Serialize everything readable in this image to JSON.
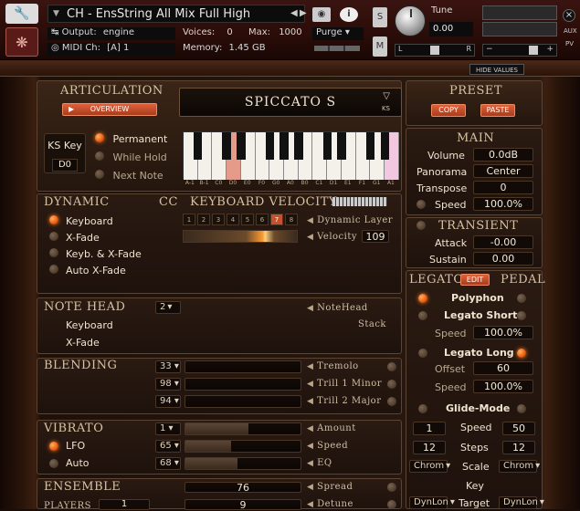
{
  "header": {
    "title": "CH - EnsString All Mix Full High",
    "output_label": "Output:",
    "output_value": "engine",
    "voices_label": "Voices:",
    "voices_value": "0",
    "max_label": "Max:",
    "max_value": "1000",
    "purge_label": "Purge",
    "midi_label": "MIDI Ch:",
    "midi_value": "[A] 1",
    "memory_label": "Memory:",
    "memory_value": "1.45 GB",
    "solo_label": "S",
    "mute_label": "M",
    "tune_label": "Tune",
    "tune_value": "0.00",
    "pan_left": "L",
    "pan_right": "R",
    "aux_label": "AUX",
    "pv_label": "PV",
    "vol_minus": "−",
    "vol_plus": "+",
    "hide_values": "HIDE VALUES"
  },
  "articulation": {
    "title": "ARTICULATION",
    "overview_label": "OVERVIEW",
    "selected": "SPICCATO S",
    "ks_badge": "KS",
    "ks_key_label": "KS Key",
    "ks_key_value": "D0",
    "modes": [
      {
        "label": "Permanent",
        "active": true
      },
      {
        "label": "While Hold",
        "active": false
      },
      {
        "label": "Next Note",
        "active": false
      }
    ],
    "key_labels": [
      "A-1",
      "B-1",
      "C0",
      "D0",
      "E0",
      "F0",
      "G0",
      "A0",
      "B0",
      "C1",
      "D1",
      "E1",
      "F1",
      "G1",
      "A1"
    ]
  },
  "preset": {
    "title": "PRESET",
    "copy_label": "COPY",
    "paste_label": "PASTE"
  },
  "main": {
    "title": "MAIN",
    "volume_label": "Volume",
    "volume_value": "0.0dB",
    "panorama_label": "Panorama",
    "panorama_value": "Center",
    "transpose_label": "Transpose",
    "transpose_value": "0",
    "speed_label": "Speed",
    "speed_value": "100.0%"
  },
  "transient": {
    "title": "TRANSIENT",
    "attack_label": "Attack",
    "attack_value": "-0.00",
    "sustain_label": "Sustain",
    "sustain_value": "0.00"
  },
  "legato": {
    "title": "LEGATO",
    "edit_label": "EDIT",
    "pedal_label": "PEDAL",
    "polyphon_label": "Polyphon",
    "legato_short_label": "Legato Short",
    "short_speed_label": "Speed",
    "short_speed_value": "100.0%",
    "legato_long_label": "Legato Long",
    "offset_label": "Offset",
    "offset_value": "60",
    "long_speed_label": "Speed",
    "long_speed_value": "100.0%",
    "glide_label": "Glide-Mode",
    "glide_left_value": "1",
    "glide_speed_label": "Speed",
    "glide_speed_value": "50",
    "steps_left_value": "12",
    "steps_label": "Steps",
    "steps_value": "12",
    "chrom_left": "Chrom",
    "scale_label": "Scale",
    "chrom_right": "Chrom",
    "key_label": "Key",
    "dynlon_left": "DynLon",
    "target_label": "Target",
    "dynlon_right": "DynLon"
  },
  "dynamic": {
    "title": "DYNAMIC",
    "cc_label": "CC",
    "options": [
      {
        "label": "Keyboard",
        "active": true
      },
      {
        "label": "X-Fade",
        "active": false
      },
      {
        "label": "Keyb. & X-Fade",
        "active": false
      },
      {
        "label": "Auto X-Fade",
        "active": false
      }
    ],
    "kv_title": "KEYBOARD VELOCITY",
    "layers": [
      "1",
      "2",
      "3",
      "4",
      "5",
      "6",
      "7",
      "8"
    ],
    "active_layer": 7,
    "dynamic_layer_label": "Dynamic Layer",
    "velocity_label": "Velocity",
    "velocity_value": "109"
  },
  "notehead": {
    "title": "NOTE HEAD",
    "value": "2",
    "notehead_label": "NoteHead",
    "stack_label": "Stack",
    "options": [
      "Keyboard",
      "X-Fade"
    ]
  },
  "blending": {
    "title": "BLENDING",
    "rows": [
      {
        "value": "33",
        "label": "Tremolo",
        "level": 0
      },
      {
        "value": "98",
        "label": "Trill 1 Minor",
        "level": 0
      },
      {
        "value": "94",
        "label": "Trill 2 Major",
        "level": 0
      }
    ]
  },
  "vibrato": {
    "title": "VIBRATO",
    "rows": [
      {
        "value": "1",
        "label": "Amount",
        "toggle": "",
        "level": 0.55
      },
      {
        "value": "65",
        "label": "Speed",
        "toggle": "LFO",
        "active": true,
        "level": 0.4
      },
      {
        "value": "68",
        "label": "EQ",
        "toggle": "Auto",
        "active": false,
        "level": 0.45
      }
    ]
  },
  "ensemble": {
    "title": "ENSEMBLE",
    "players_label": "PLAYERS",
    "players_value": "1",
    "rows": [
      {
        "value": "76",
        "label": "Spread"
      },
      {
        "value": "9",
        "label": "Detune"
      }
    ]
  }
}
